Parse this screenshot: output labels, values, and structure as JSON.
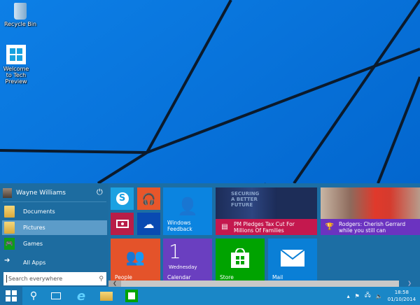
{
  "desktop": {
    "icons": [
      {
        "label": "Recycle Bin"
      },
      {
        "label": "Welcome to Tech Preview"
      }
    ]
  },
  "start_menu": {
    "user_name": "Wayne Williams",
    "places": [
      {
        "label": "Documents",
        "icon": "folder-icon"
      },
      {
        "label": "Pictures",
        "icon": "folder-icon",
        "selected": true
      },
      {
        "label": "Games",
        "icon": "games-icon"
      }
    ],
    "all_apps": "All Apps",
    "search_placeholder": "Search everywhere",
    "tiles": {
      "feedback": "Windows Feedback",
      "news_headline": "PM Pledges Tax Cut For Millions Of Families",
      "news_image_text": "SECURING A BETTER FUTURE",
      "sport_headline": "Rodgers: Cherish Gerrard while you still can",
      "people": "People",
      "calendar_day": "1",
      "calendar_weekday": "Wednesday",
      "calendar": "Calendar",
      "store": "Store",
      "mail": "Mail"
    },
    "colors": {
      "skype": "#1ba1e2",
      "music": "#e8562a",
      "video": "#b91d47",
      "onedrive": "#094ab2",
      "feedback": "#0b84e0",
      "people": "#e4532a",
      "calendar": "#6a3fc0",
      "store": "#00a300",
      "mail": "#0a7fd6",
      "news_bar": "#c4184e",
      "sport_bar": "#6b33c0"
    }
  },
  "taskbar": {
    "time": "18:58",
    "date": "01/10/2014"
  }
}
